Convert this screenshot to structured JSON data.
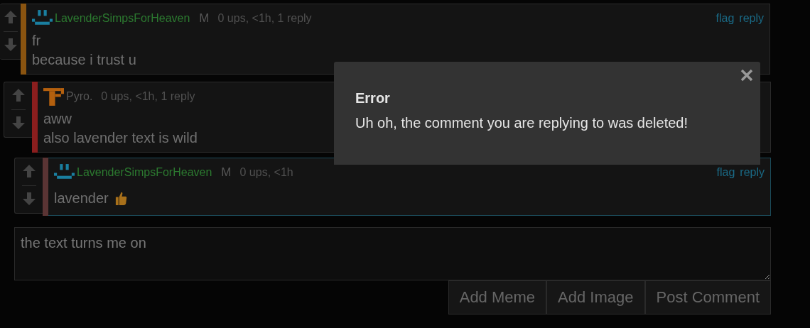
{
  "comments": [
    {
      "author": {
        "name": "LavenderSimpsForHeaven",
        "color": "#2c7a30"
      },
      "avatar": {
        "kind": "smiley"
      },
      "badge": "M",
      "meta": "0 ups, <1h, 1 reply",
      "color": "#8a5410",
      "highlighted": false,
      "links": [
        "flag",
        "reply"
      ],
      "lines": [
        "fr",
        "because i trust u"
      ],
      "thumb": false
    },
    {
      "author": {
        "name": "Pyro.",
        "color": "#555555"
      },
      "avatar": {
        "kind": "letter"
      },
      "meta": "0 ups, <1h, 1 reply",
      "color": "#8b1e1e",
      "highlighted": false,
      "lines": [
        "aww",
        "also lavender text is wild"
      ],
      "thumb": false
    },
    {
      "author": {
        "name": "LavenderSimpsForHeaven",
        "color": "#2c7a30"
      },
      "avatar": {
        "kind": "smiley"
      },
      "badge": "M",
      "meta": "0 ups, <1h",
      "color": "#5a3434",
      "highlighted": true,
      "links": [
        "flag",
        "reply"
      ],
      "lines": [
        "lavender"
      ],
      "thumb": true
    }
  ],
  "composer": {
    "value": "the text turns me on",
    "buttons": [
      "Add Meme",
      "Add Image",
      "Post Comment"
    ]
  },
  "dialog": {
    "title": "Error",
    "message": "Uh oh, the comment you are replying to was deleted!"
  }
}
